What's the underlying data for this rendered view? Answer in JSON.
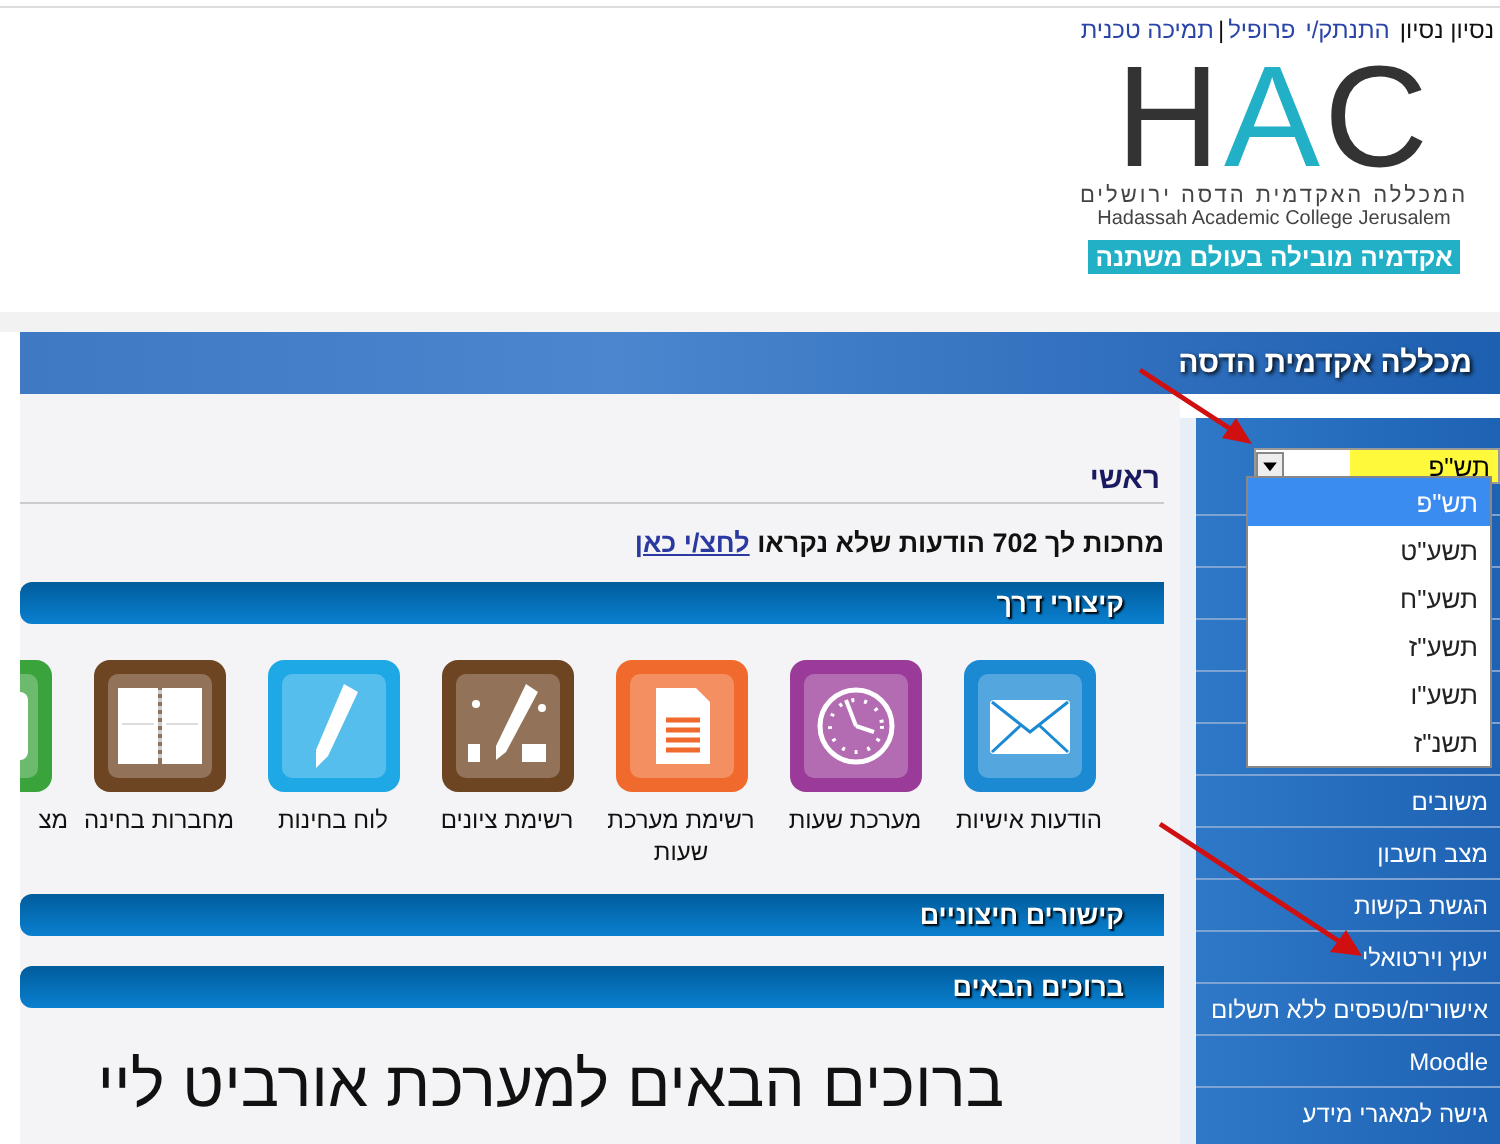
{
  "header": {
    "items": [
      {
        "kind": "text",
        "label": "נסיון נסיון"
      },
      {
        "kind": "link",
        "label": "התנתק/י"
      },
      {
        "kind": "link",
        "label": "פרופיל"
      },
      {
        "kind": "separator",
        "label": "|"
      },
      {
        "kind": "link",
        "label": "תמיכה טכנית"
      }
    ]
  },
  "logo": {
    "mark": "HAC",
    "hebrew_name": "המכללה האקדמית הדסה ירושלים",
    "english_name": "Hadassah Academic College Jerusalem",
    "tagline": "אקדמיה מובילה בעולם משתנה"
  },
  "title_bar": {
    "title": "מכללה אקדמית הדסה"
  },
  "sidebar": {
    "year_select": {
      "value": "תש\"פ",
      "expanded": true,
      "options": [
        {
          "label": "תש\"פ",
          "selected": true
        },
        {
          "label": "תשע\"ט",
          "selected": false
        },
        {
          "label": "תשע\"ח",
          "selected": false
        },
        {
          "label": "תשע\"ז",
          "selected": false
        },
        {
          "label": "תשע\"ו",
          "selected": false
        },
        {
          "label": "תשנ\"ז",
          "selected": false
        }
      ]
    },
    "items": [
      "משובים",
      "מצב חשבון",
      "הגשת בקשות",
      "יעוץ וירטואלי",
      "אישורים/טפסים ללא תשלום",
      "Moodle",
      "גישה למאגרי מידע"
    ]
  },
  "content": {
    "breadcrumb": "ראשי",
    "notice": {
      "text": "מחכות לך 702 הודעות שלא נקראו",
      "link": "לחצ/י כאן"
    },
    "shortcuts_title": "קיצורי דרך",
    "shortcuts": [
      {
        "kind": "envelope",
        "color": "#1b8ad3",
        "label": "הודעות אישיות"
      },
      {
        "kind": "clock",
        "color": "#9a3b99",
        "label": "מערכת שעות"
      },
      {
        "kind": "document",
        "color": "#ef6a2c",
        "label": "רשימת מערכת שעות"
      },
      {
        "kind": "pen-grades",
        "color": "#6e4523",
        "label": "רשימת ציונים"
      },
      {
        "kind": "pen",
        "color": "#1ea8e6",
        "label": "לוח בחינות"
      },
      {
        "kind": "notebook",
        "color": "#6e4523",
        "label": "מחברות בחינה"
      },
      {
        "kind": "generic",
        "color": "#3aa33c",
        "label": "מצ"
      }
    ],
    "links_title": "קישורים חיצוניים",
    "welcome_title": "ברוכים הבאים",
    "welcome_heading": "ברוכים הבאים למערכת אורביט ליי"
  }
}
